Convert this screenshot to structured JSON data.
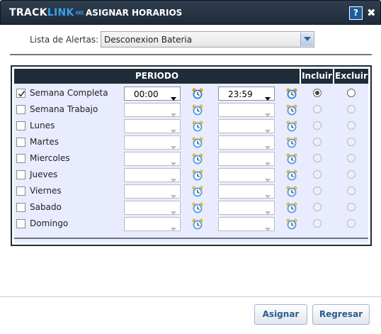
{
  "header": {
    "brand_part1": "TRACK",
    "brand_part2": "LINK",
    "brand_chevrons": "‹‹‹",
    "title": "ASIGNAR HORARIOS",
    "help_label": "?",
    "close_label": "✖",
    "brand_colors": {
      "dark": "#1e2b39",
      "accent": "#3aa0e6"
    }
  },
  "alerts": {
    "label": "Lista de Alertas:",
    "selected": "Desconexion Bateria"
  },
  "schedule": {
    "header_periodo": "PERIODO",
    "header_incluir": "Incluir",
    "header_excluir": "Excluir",
    "rows": [
      {
        "day": "Semana Completa",
        "checked": true,
        "start": "00:00",
        "end": "23:59",
        "enabled": true,
        "incluir": true,
        "excluir": false
      },
      {
        "day": "Semana Trabajo",
        "checked": false,
        "start": "",
        "end": "",
        "enabled": false,
        "incluir": false,
        "excluir": false
      },
      {
        "day": "Lunes",
        "checked": false,
        "start": "",
        "end": "",
        "enabled": false,
        "incluir": false,
        "excluir": false
      },
      {
        "day": "Martes",
        "checked": false,
        "start": "",
        "end": "",
        "enabled": false,
        "incluir": false,
        "excluir": false
      },
      {
        "day": "Miercoles",
        "checked": false,
        "start": "",
        "end": "",
        "enabled": false,
        "incluir": false,
        "excluir": false
      },
      {
        "day": "Jueves",
        "checked": false,
        "start": "",
        "end": "",
        "enabled": false,
        "incluir": false,
        "excluir": false
      },
      {
        "day": "Viernes",
        "checked": false,
        "start": "",
        "end": "",
        "enabled": false,
        "incluir": false,
        "excluir": false
      },
      {
        "day": "Sabado",
        "checked": false,
        "start": "",
        "end": "",
        "enabled": false,
        "incluir": false,
        "excluir": false
      },
      {
        "day": "Domingo",
        "checked": false,
        "start": "",
        "end": "",
        "enabled": false,
        "incluir": false,
        "excluir": false
      }
    ]
  },
  "footer": {
    "assign_label": "Asignar",
    "back_label": "Regresar"
  },
  "icons": {
    "help": "help-icon",
    "close": "close-icon",
    "clock": "alarm-clock-icon",
    "dropdown": "chevron-down-icon"
  }
}
